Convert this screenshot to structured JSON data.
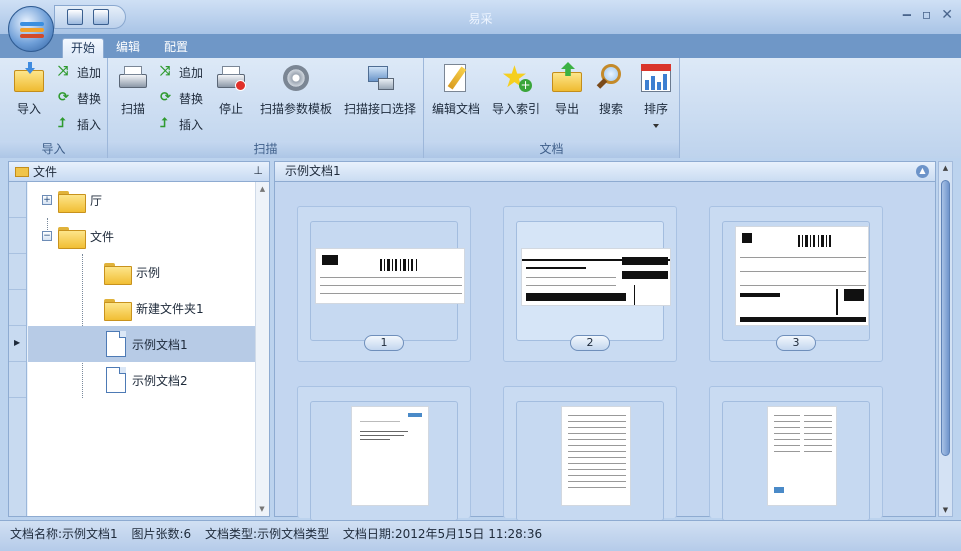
{
  "window": {
    "title": "易采"
  },
  "tabs": [
    {
      "label": "开始"
    },
    {
      "label": "编辑"
    },
    {
      "label": "配置"
    }
  ],
  "ribbon": {
    "import_group": {
      "label": "导入",
      "import": "导入",
      "append": "追加",
      "replace": "替换",
      "insert": "插入"
    },
    "scan_group": {
      "label": "扫描",
      "scan": "扫描",
      "append": "追加",
      "replace": "替换",
      "insert": "插入",
      "stop": "停止",
      "param_template": "扫描参数模板",
      "interface_select": "扫描接口选择"
    },
    "doc_group": {
      "label": "文档",
      "edit_doc": "编辑文档",
      "import_index": "导入索引",
      "export": "导出",
      "search": "搜索",
      "sort": "排序"
    }
  },
  "left_panel": {
    "title": "文件",
    "pin_icon": "pin-icon",
    "tree": [
      {
        "label": "厅",
        "type": "folder",
        "expander": "+"
      },
      {
        "label": "文件",
        "type": "folder",
        "expander": "−"
      },
      {
        "label": "示例",
        "type": "folder"
      },
      {
        "label": "新建文件夹1",
        "type": "folder"
      },
      {
        "label": "示例文档1",
        "type": "document",
        "selected": true
      },
      {
        "label": "示例文档2",
        "type": "document"
      }
    ]
  },
  "main_panel": {
    "title": "示例文档1",
    "pages": [
      {
        "number": "1"
      },
      {
        "number": "2"
      },
      {
        "number": "3"
      }
    ]
  },
  "status": {
    "doc_name": "文档名称:示例文档1",
    "page_count": "图片张数:6",
    "doc_type": "文档类型:示例文档类型",
    "doc_date": "文档日期:2012年5月15日 11:28:36"
  }
}
